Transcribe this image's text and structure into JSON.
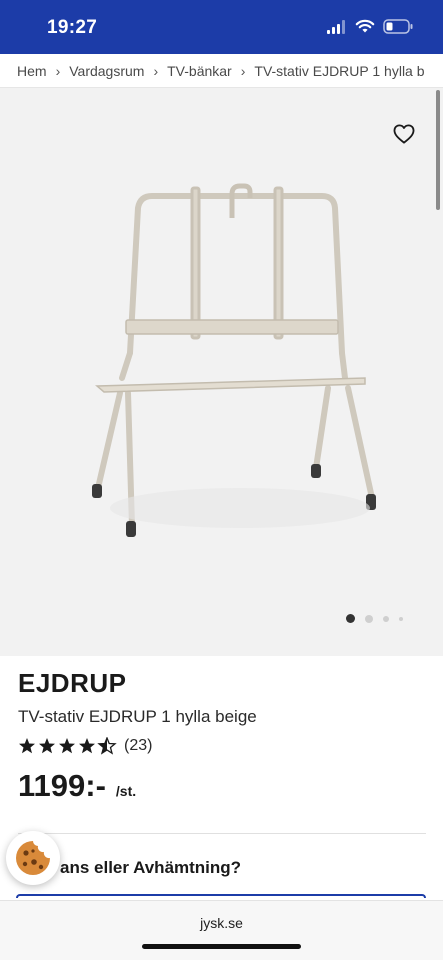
{
  "status_bar": {
    "time": "19:27",
    "icons": [
      "signal-icon",
      "wifi-icon",
      "battery-icon"
    ]
  },
  "breadcrumb": [
    {
      "label": "Hem"
    },
    {
      "label": "Vardagsrum"
    },
    {
      "label": "TV-bänkar"
    },
    {
      "label": "TV-stativ EJDRUP 1 hylla b"
    }
  ],
  "gallery": {
    "image_count": 4,
    "active_index": 0
  },
  "product": {
    "brand": "EJDRUP",
    "name": "TV-stativ EJDRUP 1 hylla beige",
    "rating_stars": 4.5,
    "rating_count": "(23)",
    "price": "1199:-",
    "price_unit": "/st."
  },
  "delivery": {
    "question": "ans eller Avhämtning?"
  },
  "browser": {
    "url": "jysk.se"
  },
  "colors": {
    "brand_blue": "#1c3ca8",
    "gallery_bg": "#f2f2f2",
    "product_beige": "#d9d3c7"
  }
}
